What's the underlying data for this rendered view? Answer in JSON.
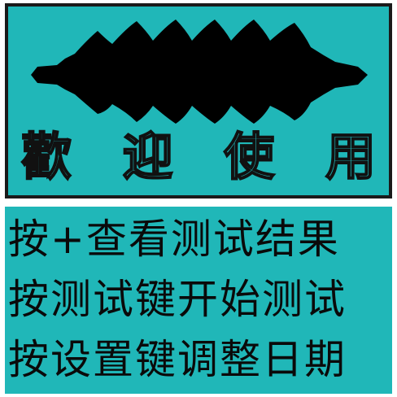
{
  "welcome_panel": {
    "chars": [
      "歡",
      "迎",
      "使",
      "用"
    ]
  },
  "instructions": [
    "按+查看测试结果",
    "按测试键开始测试",
    "按设置键调整日期"
  ],
  "colors": {
    "lcd_background": "#20B7B8",
    "lcd_ink": "#0a0a0a",
    "border": "#1a1a1a"
  },
  "icons": {
    "logo": "wavy-black-blob-logo"
  }
}
